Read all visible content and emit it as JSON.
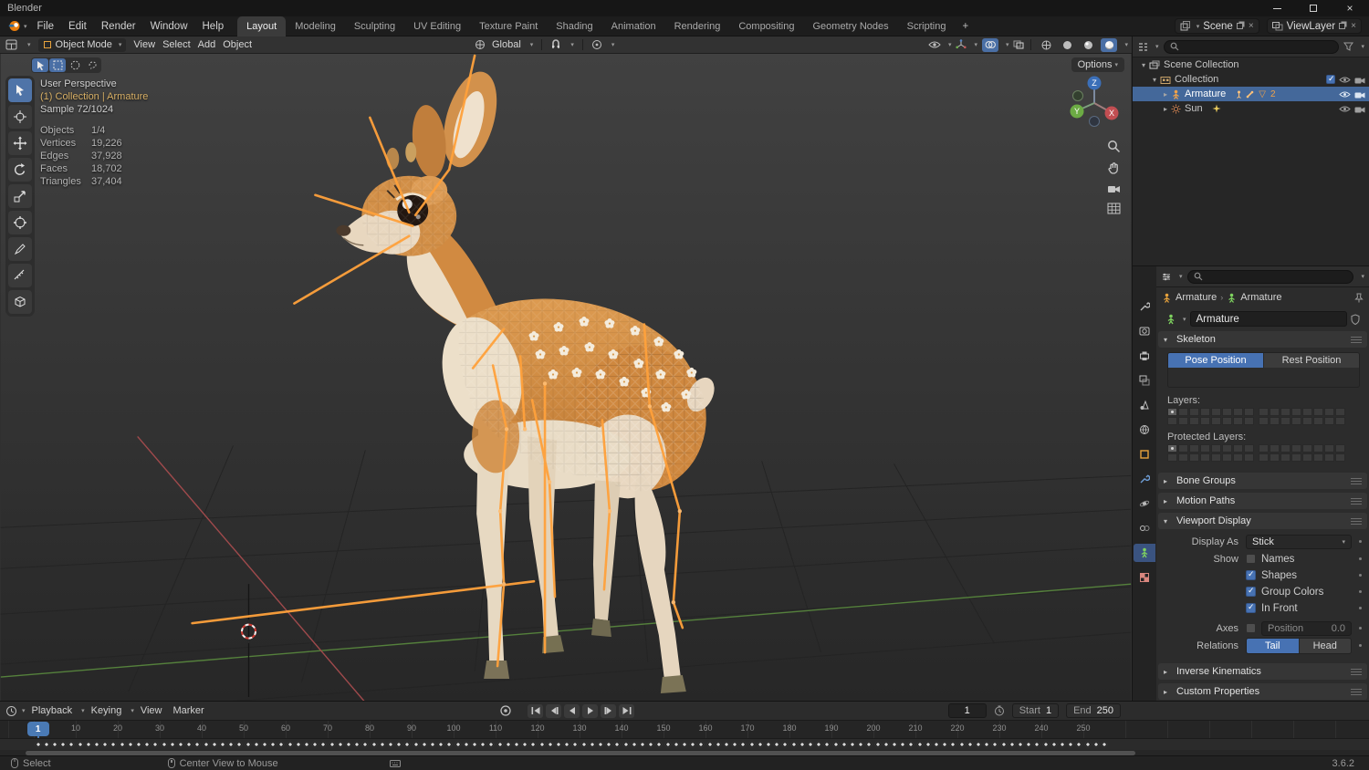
{
  "window": {
    "title": "Blender"
  },
  "menubar": {
    "menus": [
      "File",
      "Edit",
      "Render",
      "Window",
      "Help"
    ],
    "workspaces": [
      {
        "label": "Layout",
        "active": true
      },
      {
        "label": "Modeling"
      },
      {
        "label": "Sculpting"
      },
      {
        "label": "UV Editing"
      },
      {
        "label": "Texture Paint"
      },
      {
        "label": "Shading"
      },
      {
        "label": "Animation"
      },
      {
        "label": "Rendering"
      },
      {
        "label": "Compositing"
      },
      {
        "label": "Geometry Nodes"
      },
      {
        "label": "Scripting"
      }
    ],
    "add": "+",
    "scene": "Scene",
    "view_layer": "ViewLayer"
  },
  "viewport_header": {
    "mode": "Object Mode",
    "menus": [
      "View",
      "Select",
      "Add",
      "Object"
    ],
    "orientation": "Global",
    "options": "Options"
  },
  "viewport": {
    "overlay": {
      "line1": "User Perspective",
      "line2": "(1) Collection | Armature",
      "line3": "Sample 72/1024",
      "stats": [
        {
          "label": "Objects",
          "value": "1/4"
        },
        {
          "label": "Vertices",
          "value": "19,226"
        },
        {
          "label": "Edges",
          "value": "37,928"
        },
        {
          "label": "Faces",
          "value": "18,702"
        },
        {
          "label": "Triangles",
          "value": "37,404"
        }
      ]
    },
    "gizmo": {
      "x": "X",
      "y": "Y",
      "z": "Z"
    }
  },
  "outliner": {
    "rows": [
      {
        "label": "Scene Collection"
      },
      {
        "label": "Collection"
      },
      {
        "label": "Armature",
        "badge": "2"
      },
      {
        "label": "Sun"
      }
    ]
  },
  "properties": {
    "breadcrumb": {
      "first": "Armature",
      "second": "Armature"
    },
    "name": "Armature",
    "skeleton": {
      "title": "Skeleton",
      "pose": "Pose Position",
      "rest": "Rest Position",
      "layers_label": "Layers:",
      "protected_label": "Protected Layers:"
    },
    "panels": {
      "bone_groups": "Bone Groups",
      "motion_paths": "Motion Paths",
      "viewport_display": "Viewport Display",
      "inverse_kinematics": "Inverse Kinematics",
      "custom_properties": "Custom Properties"
    },
    "display": {
      "display_as_label": "Display As",
      "display_as": "Stick",
      "rows": [
        {
          "left": "Show",
          "label": "Names",
          "checked": false
        },
        {
          "left": "",
          "label": "Shapes",
          "checked": true
        },
        {
          "left": "",
          "label": "Group Colors",
          "checked": true
        },
        {
          "left": "",
          "label": "In Front",
          "checked": true
        }
      ],
      "axes_label": "Axes",
      "position_label": "Position",
      "position_value": "0.0",
      "relations_label": "Relations",
      "tail": "Tail",
      "head": "Head"
    }
  },
  "timeline": {
    "menus": [
      "Playback",
      "Keying",
      "View",
      "Marker"
    ],
    "frame": "1",
    "playhead": "1",
    "start_label": "Start",
    "start": "1",
    "end_label": "End",
    "end": "250",
    "ticks": [
      10,
      20,
      30,
      40,
      50,
      60,
      70,
      80,
      90,
      100,
      110,
      120,
      130,
      140,
      150,
      160,
      170,
      180,
      190,
      200,
      210,
      220,
      230,
      240,
      250
    ],
    "keyframes": {
      "from": 1,
      "to": 255,
      "step": 2
    }
  },
  "status": {
    "select": "Select",
    "center": "Center View to Mouse",
    "version": "3.6.2"
  }
}
